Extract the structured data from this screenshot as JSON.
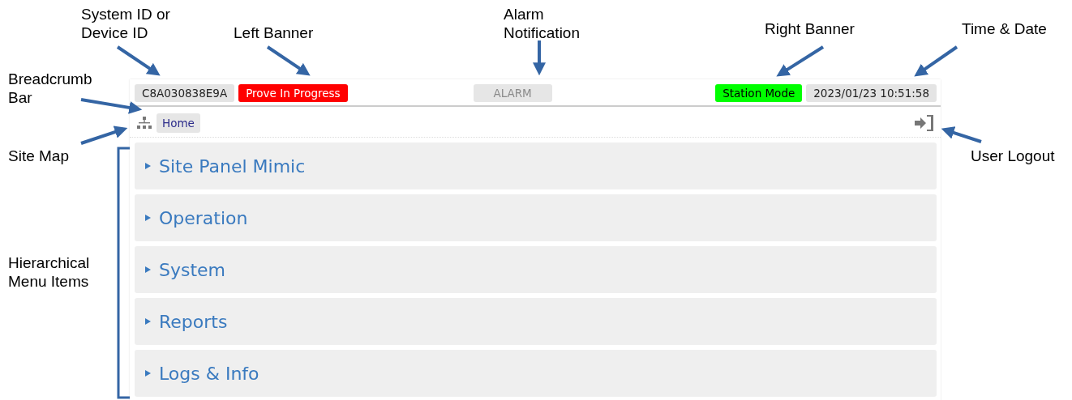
{
  "annotations": [
    {
      "text": "System ID or\nDevice ID"
    },
    {
      "text": "Left Banner"
    },
    {
      "text": "Alarm\nNotification"
    },
    {
      "text": "Right Banner"
    },
    {
      "text": "Time & Date"
    },
    {
      "text": "Breadcrumb\nBar"
    },
    {
      "text": "Site Map"
    },
    {
      "text": "User Logout"
    },
    {
      "text": "Hierarchical\nMenu Items"
    }
  ],
  "top_bar": {
    "device_id": "C8A030838E9A",
    "left_banner": {
      "text": "Prove In Progress",
      "color": "#ff0000"
    },
    "alarm": {
      "text": "ALARM",
      "active": false
    },
    "right_banner": {
      "text": "Station Mode",
      "color": "#00ff00"
    },
    "datetime": "2023/01/23 10:51:58"
  },
  "breadcrumb": [
    {
      "label": "Home"
    }
  ],
  "menu_items": [
    {
      "label": "Site Panel Mimic",
      "expanded": false
    },
    {
      "label": "Operation",
      "expanded": false
    },
    {
      "label": "System",
      "expanded": false
    },
    {
      "label": "Reports",
      "expanded": false
    },
    {
      "label": "Logs & Info",
      "expanded": false
    }
  ]
}
